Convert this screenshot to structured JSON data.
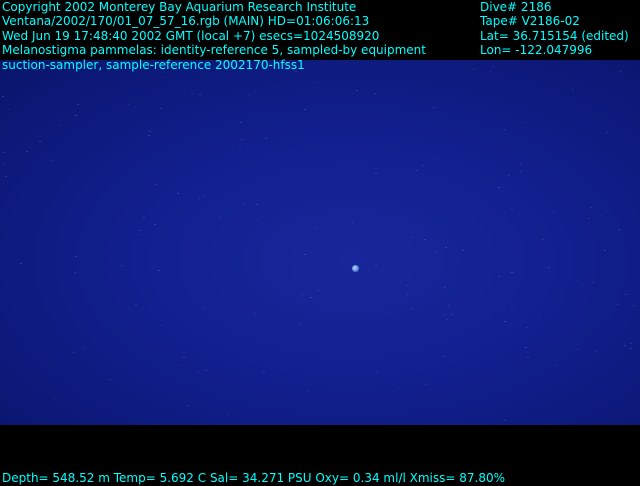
{
  "overlay": {
    "copyright": "Copyright 2002 Monterey Bay Aquarium Research Institute",
    "source": "Ventana/2002/170/01_07_57_16.rgb (MAIN)  HD=01:06:06:13",
    "datetime": "Wed Jun 19 17:48:40 2002 GMT (local +7)  esecs=1024508920",
    "species_line1": "Melanostigma pammelas: identity-reference 5, sampled-by equipment",
    "species_line2": "suction-sampler, sample-reference 2002170-hfss1",
    "dive": "Dive# 2186",
    "tape": "Tape# V2186-02",
    "lat": "Lat= 36.715154 (edited)",
    "lon": "Lon= -122.047996",
    "sensors": "Depth= 548.52 m  Temp= 5.692 C  Sal= 34.271 PSU  Oxy= 0.34 ml/l  Xmiss= 87.80%"
  },
  "colors": {
    "overlay_text": "#00ffff",
    "water": "#122090",
    "border": "#000000"
  }
}
